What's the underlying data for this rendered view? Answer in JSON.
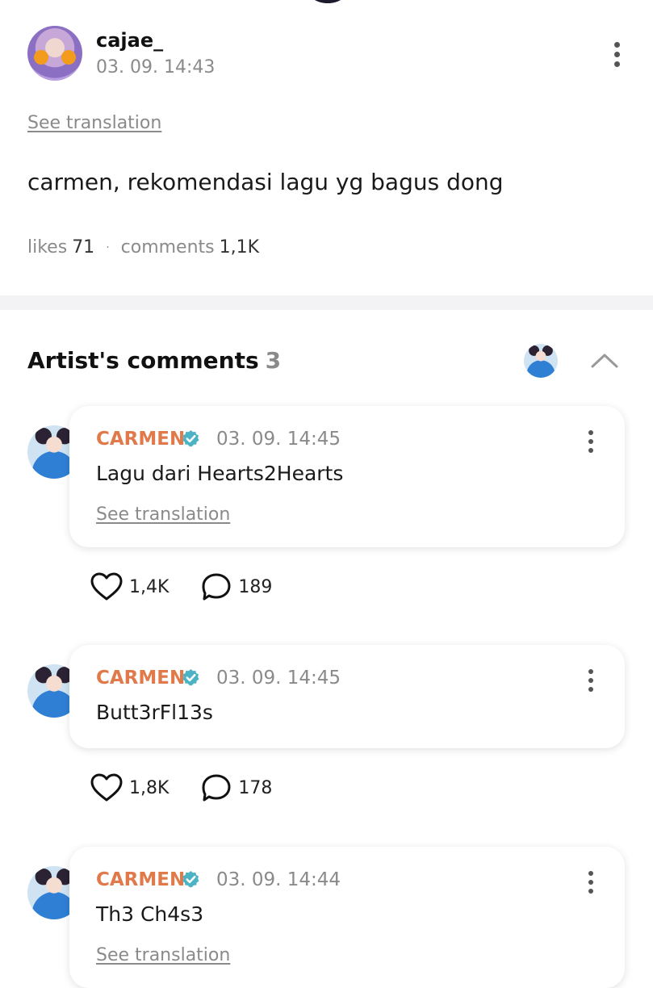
{
  "post": {
    "username": "cajae_",
    "date": "03. 09. 14:43",
    "see_translation": "See translation",
    "body": "carmen, rekomendasi lagu yg bagus dong",
    "likes_label": "likes",
    "likes_count": "71",
    "comments_label": "comments",
    "comments_count": "1,1K",
    "separator": "·"
  },
  "artist_comments": {
    "title": "Artist's comments",
    "count": "3",
    "comments": [
      {
        "name": "CARMEN",
        "date": "03. 09. 14:45",
        "text": "Lagu dari Hearts2Hearts",
        "see_translation": "See translation",
        "likes": "1,4K",
        "replies": "189"
      },
      {
        "name": "CARMEN",
        "date": "03. 09. 14:45",
        "text": "Butt3rFl13s",
        "likes": "1,8K",
        "replies": "178"
      },
      {
        "name": "CARMEN",
        "date": "03. 09. 14:44",
        "text": "Th3 Ch4s3",
        "see_translation": "See translation"
      }
    ]
  },
  "colors": {
    "artist_name": "#e07a4a",
    "verified_badge": "#4bb3c4",
    "muted_text": "#8a8a8a",
    "divider": "#f3f3f5"
  },
  "icons": {
    "more": "kebab-vertical-icon",
    "collapse": "chevron-up-icon",
    "verified": "verified-check-icon",
    "like": "heart-outline-icon",
    "reply": "speech-bubble-icon"
  }
}
